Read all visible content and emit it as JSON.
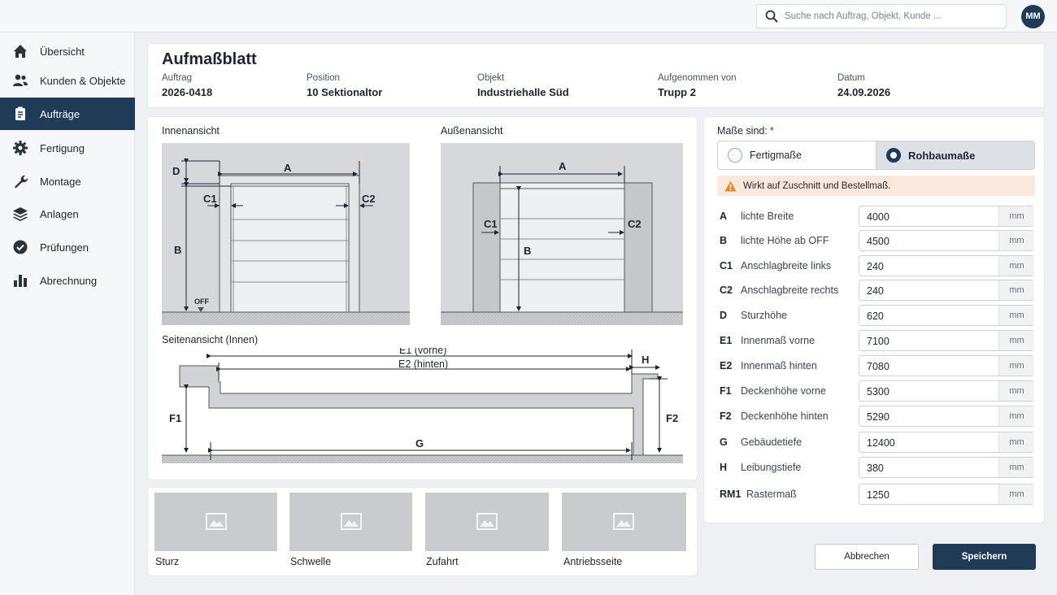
{
  "search": {
    "placeholder": "Suche nach Auftrag, Objekt, Kunde ..."
  },
  "user": {
    "initials": "MM"
  },
  "sidebar": {
    "items": [
      {
        "label": "Übersicht",
        "icon": "home-icon"
      },
      {
        "label": "Kunden & Objekte",
        "icon": "users-icon"
      },
      {
        "label": "Aufträge",
        "icon": "clipboard-icon",
        "active": true
      },
      {
        "label": "Fertigung",
        "icon": "gear-icon"
      },
      {
        "label": "Montage",
        "icon": "wrench-icon"
      },
      {
        "label": "Anlagen",
        "icon": "layers-icon"
      },
      {
        "label": "Prüfungen",
        "icon": "check-circle-icon"
      },
      {
        "label": "Abrechnung",
        "icon": "bar-chart-icon"
      }
    ]
  },
  "header": {
    "title": "Aufmaßblatt",
    "fields": [
      {
        "label": "Auftrag",
        "value": "2026-0418"
      },
      {
        "label": "Position",
        "value": "10 Sektionaltor"
      },
      {
        "label": "Objekt",
        "value": "Industriehalle Süd"
      },
      {
        "label": "Aufgenommen von",
        "value": "Trupp 2"
      },
      {
        "label": "Datum",
        "value": "24.09.2026"
      }
    ]
  },
  "drawings": {
    "inner_title": "Innenansicht",
    "outer_title": "Außenansicht",
    "side_title": "Seitenansicht (Innen)",
    "labels": {
      "A": "A",
      "B": "B",
      "C1": "C1",
      "C2": "C2",
      "D": "D",
      "OFF": "OFF",
      "E1": "E1 (vorne)",
      "E2": "E2 (hinten)",
      "F1": "F1",
      "F2": "F2",
      "G": "G",
      "H": "H"
    }
  },
  "photos": [
    {
      "label": "Sturz"
    },
    {
      "label": "Schwelle"
    },
    {
      "label": "Zufahrt"
    },
    {
      "label": "Antriebsseite"
    }
  ],
  "form": {
    "mode_label": "Maße sind:",
    "required_mark": "*",
    "options": [
      {
        "label": "Fertigmaße",
        "selected": false
      },
      {
        "label": "Rohbaumaße",
        "selected": true
      }
    ],
    "warning": "Wirkt auf Zuschnitt und Bestellmaß.",
    "unit": "mm",
    "rows": [
      {
        "key": "A",
        "name": "lichte Breite",
        "value": "4000"
      },
      {
        "key": "B",
        "name": "lichte Höhe ab OFF",
        "value": "4500"
      },
      {
        "key": "C1",
        "name": "Anschlagbreite links",
        "value": "240"
      },
      {
        "key": "C2",
        "name": "Anschlagbreite rechts",
        "value": "240"
      },
      {
        "key": "D",
        "name": "Sturzhöhe",
        "value": "620"
      },
      {
        "key": "E1",
        "name": "Innenmaß vorne",
        "value": "7100"
      },
      {
        "key": "E2",
        "name": "Innenmaß hinten",
        "value": "7080"
      },
      {
        "key": "F1",
        "name": "Deckenhöhe vorne",
        "value": "5300"
      },
      {
        "key": "F2",
        "name": "Deckenhöhe hinten",
        "value": "5290"
      },
      {
        "key": "G",
        "name": "Gebäudetiefe",
        "value": "12400"
      },
      {
        "key": "H",
        "name": "Leibungstiefe",
        "value": "380"
      },
      {
        "key": "RM1",
        "name": "Rastermaß",
        "value": "1250"
      }
    ]
  },
  "actions": {
    "cancel": "Abbrechen",
    "save": "Speichern"
  },
  "colors": {
    "primary": "#1f3b57",
    "warning_bg": "#fbe8dc",
    "warning_icon": "#e8891c"
  }
}
